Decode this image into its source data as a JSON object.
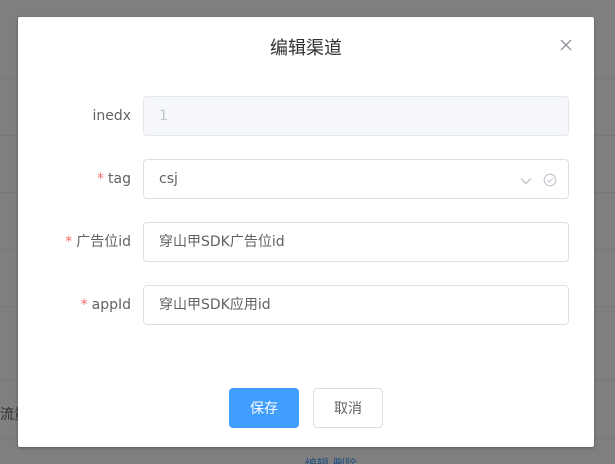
{
  "background": {
    "row_text": "流量",
    "row_links": "编辑   删除"
  },
  "dialog": {
    "title": "编辑渠道",
    "close_icon": "close-icon",
    "fields": {
      "inedx": {
        "label": "inedx",
        "value": "1",
        "required": false,
        "disabled": true
      },
      "tag": {
        "label": "tag",
        "value": "csj",
        "required": true,
        "icons": [
          "chevron-down-icon",
          "circle-check-icon"
        ]
      },
      "ad_slot_id": {
        "label": "广告位id",
        "value": "穿山甲SDK广告位id",
        "required": true
      },
      "app_id": {
        "label": "appId",
        "value": "穿山甲SDK应用id",
        "required": true
      }
    },
    "buttons": {
      "save": "保存",
      "cancel": "取消"
    }
  },
  "colors": {
    "primary": "#409eff",
    "required": "#f56c6c",
    "overlay": "rgba(0,0,0,0.5)"
  }
}
